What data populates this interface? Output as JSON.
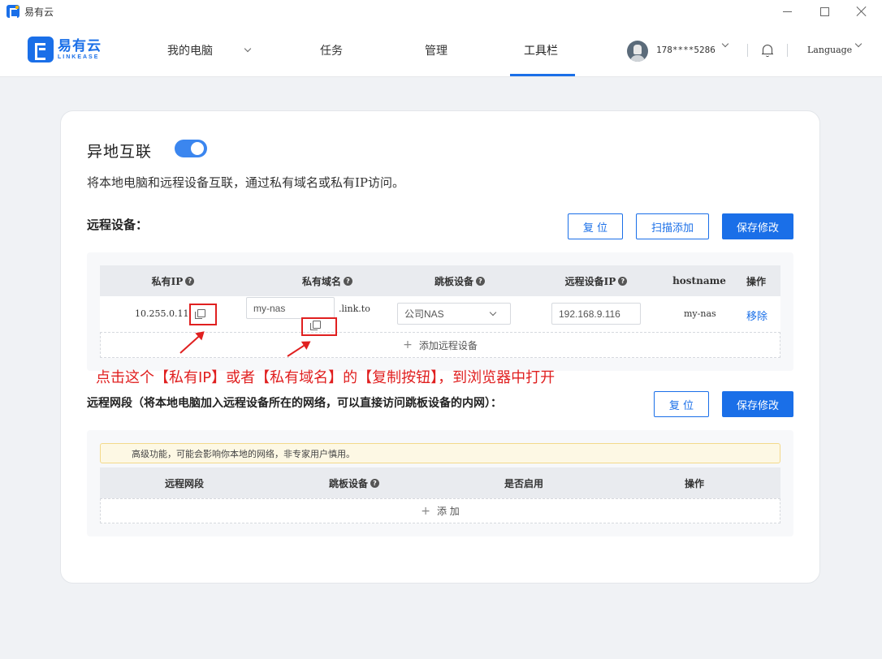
{
  "window": {
    "title": "易有云"
  },
  "brand": {
    "name": "易有云",
    "sub": "LINKEASE"
  },
  "nav": {
    "items": [
      {
        "label": "我的电脑"
      },
      {
        "label": "任务"
      },
      {
        "label": "管理"
      },
      {
        "label": "工具栏"
      }
    ],
    "user_phone": "178****5286",
    "language": "Language"
  },
  "section": {
    "title": "异地互联",
    "enabled": true,
    "description": "将本地电脑和远程设备互联，通过私有域名或私有IP访问。"
  },
  "remote_devices": {
    "title": "远程设备：",
    "buttons": {
      "reset": "复 位",
      "scan_add": "扫描添加",
      "save": "保存修改"
    },
    "columns": [
      "私有IP",
      "私有域名",
      "跳板设备",
      "远程设备IP",
      "hostname",
      "操作"
    ],
    "row": {
      "private_ip": "10.255.0.11",
      "domain_value": "my-nas",
      "domain_suffix": ".link.to",
      "jump_device": "公司NAS",
      "remote_ip": "192.168.9.116",
      "hostname": "my-nas",
      "action": "移除"
    },
    "add_label": "添加远程设备"
  },
  "annotation": "点击这个【私有IP】或者【私有域名】的【复制按钮】，到浏览器中打开",
  "remote_network": {
    "title": "远程网段（将本地电脑加入远程设备所在的网络，可以直接访问跳板设备的内网）：",
    "buttons": {
      "reset": "复 位",
      "save": "保存修改"
    },
    "notice": "高级功能，可能会影响你本地的网络，非专家用户慎用。",
    "columns": [
      "远程网段",
      "跳板设备",
      "是否启用",
      "操作"
    ],
    "add_label": "添 加"
  },
  "colors": {
    "accent": "#1a6fe8",
    "annotation": "#e02020"
  }
}
